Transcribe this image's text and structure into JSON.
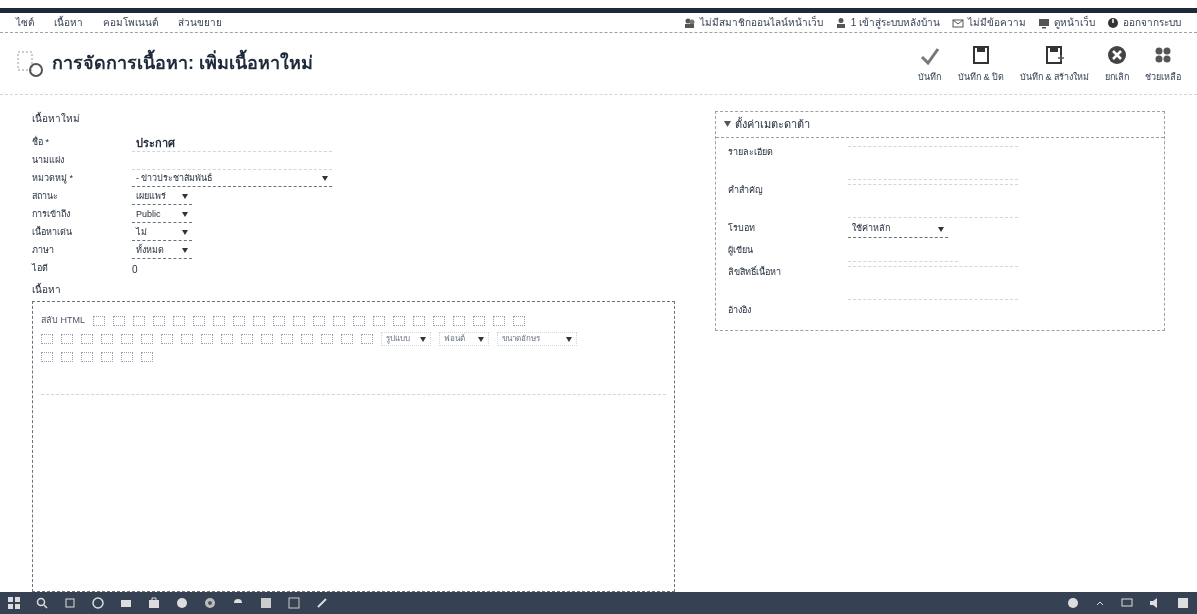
{
  "top_menu": [
    {
      "label": "ไซต์"
    },
    {
      "label": "เนื้อหา"
    },
    {
      "label": "คอมโพเนนต์"
    },
    {
      "label": "ส่วนขยาย"
    }
  ],
  "status_links": [
    {
      "label": "ไม่มีสมาชิกออนไลน์หน้าเว็บ"
    },
    {
      "label": "1 เข้าสู่ระบบหลังบ้าน"
    },
    {
      "label": "ไม่มีข้อความ"
    },
    {
      "label": "ดูหน้าเว็บ"
    },
    {
      "label": "ออกจากระบบ"
    }
  ],
  "page_title": "การจัดการเนื้อหา: เพิ่มเนื้อหาใหม่",
  "toolbar": [
    {
      "label": "บันทึก"
    },
    {
      "label": "บันทึก & ปิด"
    },
    {
      "label": "บันทึก & สร้างใหม่"
    },
    {
      "label": "ยกเลิก"
    },
    {
      "label": "ช่วยเหลือ"
    }
  ],
  "form": {
    "legend": "เนื้อหาใหม่",
    "fields": [
      {
        "label": "ชื่อ *",
        "kind": "text",
        "value": "ประกาศ"
      },
      {
        "label": "นามแฝง",
        "kind": "text"
      },
      {
        "label": "หมวดหมู่ *",
        "kind": "select",
        "value": "- ข่าวประชาสัมพันธ์"
      },
      {
        "label": "สถานะ",
        "kind": "select",
        "value": "เผยแพร่"
      },
      {
        "label": "การเข้าถึง",
        "kind": "select",
        "value": "Public"
      },
      {
        "label": "เนื้อหาเด่น",
        "kind": "select",
        "value": "ไม่"
      },
      {
        "label": "ภาษา",
        "kind": "select",
        "value": "ทั้งหมด"
      },
      {
        "label": "ไอดี",
        "kind": "static",
        "value": "0"
      }
    ],
    "content_label": "เนื้อหา",
    "editor": {
      "toggle_label": "สลับ HTML",
      "format_select": "รูปแบบ",
      "font_select": "ฟอนต์",
      "size_select": "ขนาดอักษร"
    }
  },
  "metadata": {
    "title": "ตั้งค่าเมตะดาต้า",
    "expanded": true,
    "fields": [
      {
        "label": "รายละเอียด",
        "kind": "textarea"
      },
      {
        "label": "คำสำคัญ",
        "kind": "textarea"
      },
      {
        "label": "โรบอท",
        "kind": "select",
        "value": "ใช้ค่าหลัก"
      },
      {
        "label": "ผู้เขียน",
        "kind": "text"
      },
      {
        "label": "ลิขสิทธิ์เนื้อหา",
        "kind": "textarea"
      },
      {
        "label": "อ้างอิง",
        "kind": "none"
      }
    ]
  }
}
